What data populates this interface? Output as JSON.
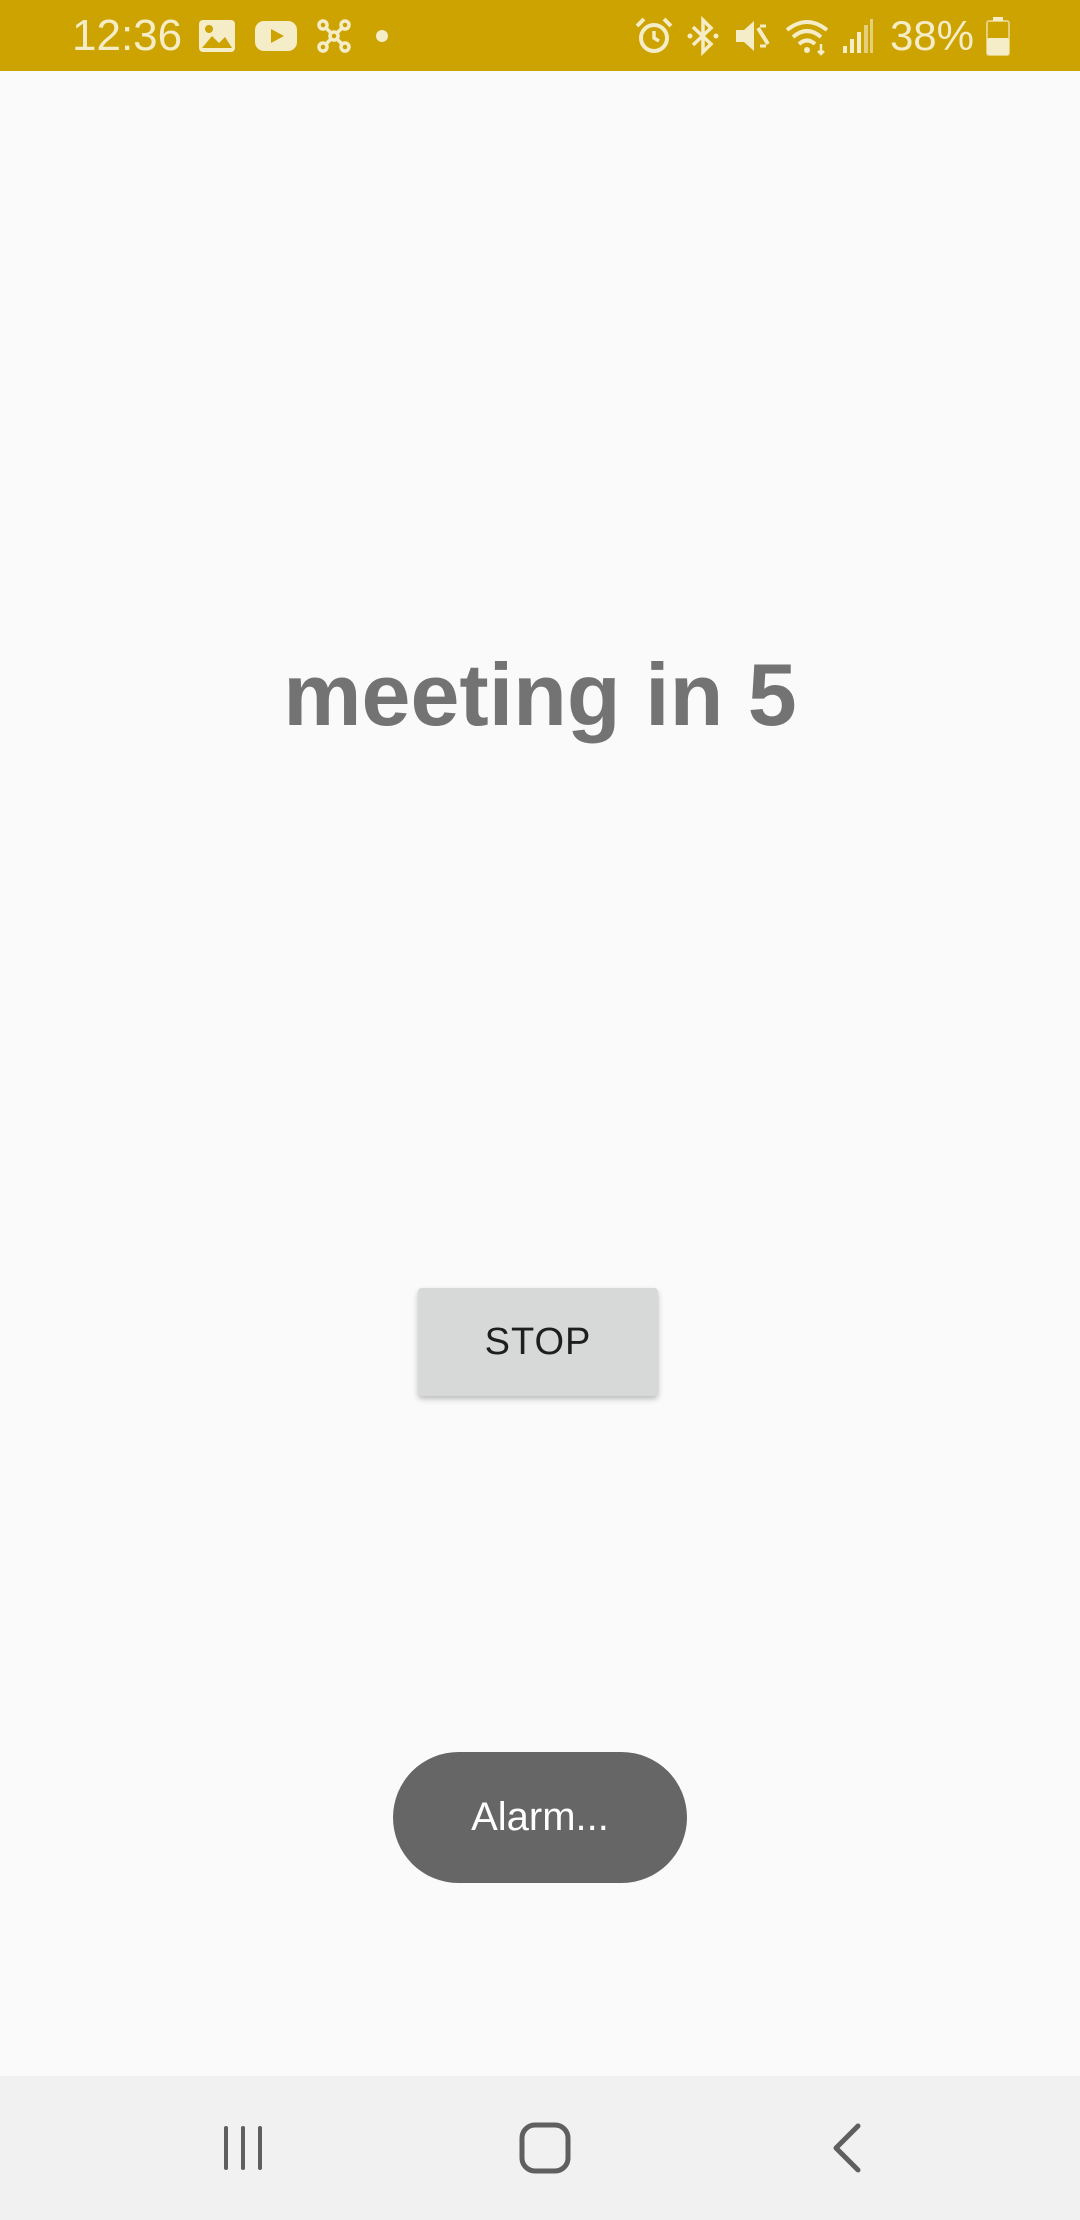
{
  "status_bar": {
    "time": "12:36",
    "battery_percent": "38%",
    "background_color": "#cca300",
    "left_icons": [
      "gallery-icon",
      "youtube-icon",
      "app-notification-icon",
      "more-notifications-dot"
    ],
    "right_icons": [
      "alarm-icon",
      "bluetooth-icon",
      "vibrate-mute-icon",
      "wifi-icon",
      "signal-icon",
      "battery-icon"
    ]
  },
  "alarm": {
    "label": "meeting in 5",
    "stop_label": "STOP"
  },
  "toast": {
    "message": "Alarm..."
  },
  "nav_bar": {
    "buttons": [
      "recents-icon",
      "home-icon",
      "back-icon"
    ]
  }
}
